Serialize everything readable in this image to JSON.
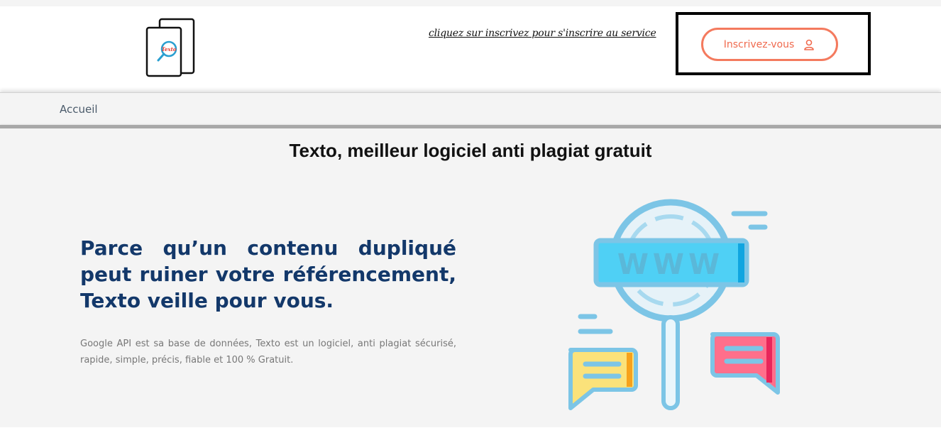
{
  "header": {
    "logo_icon": "document-search-logo-icon",
    "logo_text": "Texto",
    "signup_hint": "cliquez sur inscrivez pour s'inscrire au service",
    "signup_button": {
      "label": "Inscrivez-vous",
      "icon": "user-icon"
    }
  },
  "nav": {
    "items": [
      {
        "label": "Accueil"
      }
    ]
  },
  "hero": {
    "title": "Texto, meilleur logiciel anti plagiat gratuit",
    "heading": "Parce qu’un contenu dupliqué peut ruiner votre référencement, Texto veille pour vous.",
    "description": "Google API est sa base de données, Texto est un logiciel, anti plagiat sécurisé, rapide, simple, précis, fiable et 100 % Gratuit.",
    "illustration": {
      "icon": "magnifier-www-illustration",
      "text": "WWW"
    }
  },
  "colors": {
    "accent": "#f47a5e",
    "heading": "#13386a",
    "background": "#f4f4f4"
  }
}
